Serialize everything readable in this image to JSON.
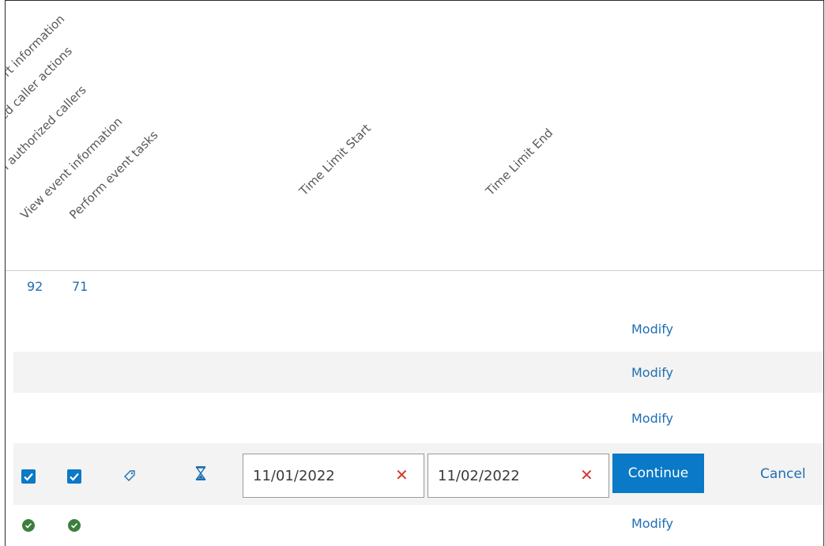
{
  "columns": {
    "col1": "port information",
    "col2": "ized caller actions",
    "col3": "gn authorized callers",
    "col4": "View event information",
    "col5": "Perform event tasks",
    "col6": "Time Limit Start",
    "col7": "Time Limit End"
  },
  "counts": {
    "c1": "92",
    "c2": "71"
  },
  "rows": {
    "modify1": "Modify",
    "modify2": "Modify",
    "modify3": "Modify",
    "modify5": "Modify"
  },
  "edit": {
    "start_date": "11/01/2022",
    "end_date": "11/02/2022",
    "clear_symbol": "✕",
    "continue_label": "Continue",
    "cancel_label": "Cancel"
  },
  "icons": {
    "checkbox": "checkbox-checked-icon",
    "tag": "tag-icon",
    "hourglass": "hourglass-icon",
    "check_circle": "check-circle-icon"
  },
  "colors": {
    "accent": "#0a79c7",
    "link": "#1f6fb2",
    "clear": "#d6372c",
    "success": "#3c7f3c"
  }
}
